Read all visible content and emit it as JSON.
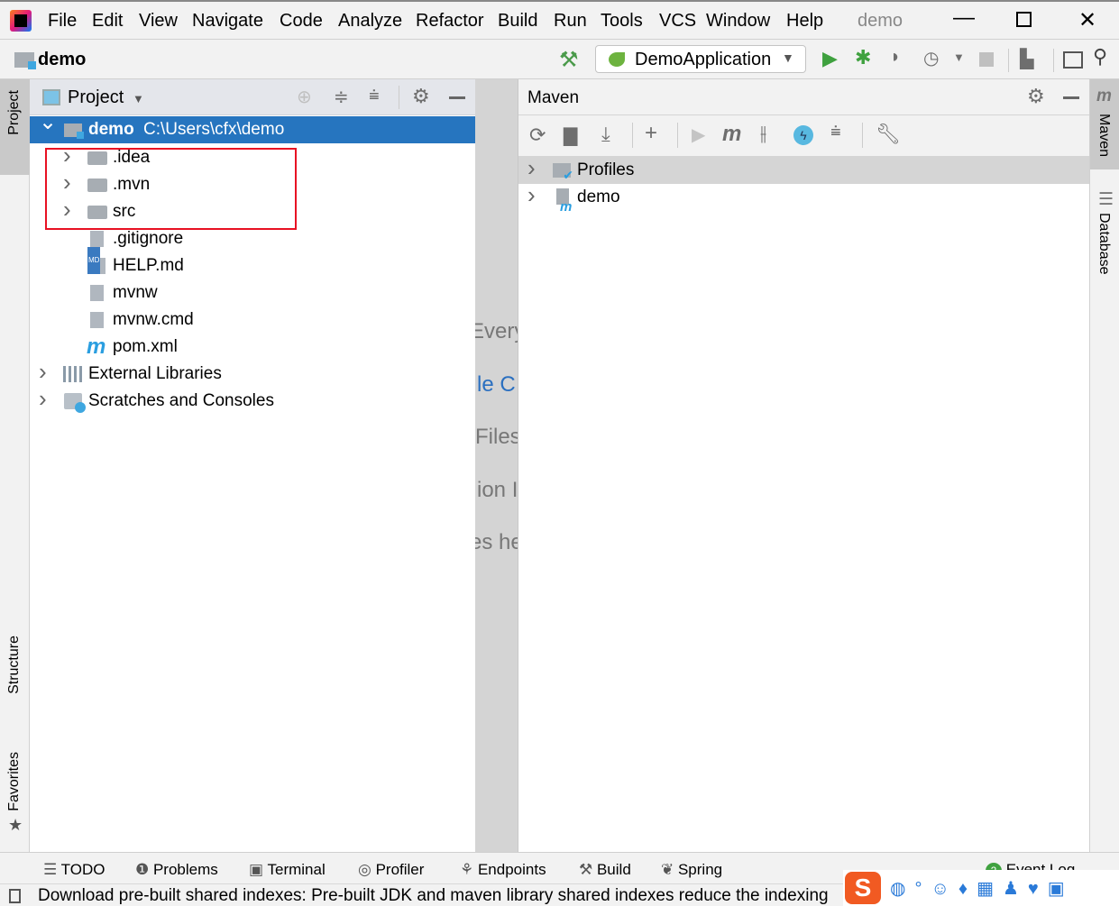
{
  "menu": {
    "items": [
      "File",
      "Edit",
      "View",
      "Navigate",
      "Code",
      "Analyze",
      "Refactor",
      "Build",
      "Run",
      "Tools",
      "VCS",
      "Window",
      "Help"
    ],
    "project_name": "demo"
  },
  "toolbar": {
    "breadcrumb": "demo",
    "run_config": "DemoApplication"
  },
  "left_stripe": {
    "tabs": [
      "Project",
      "Structure",
      "Favorites"
    ]
  },
  "project_panel": {
    "title": "Project",
    "root": {
      "name": "demo",
      "path": "C:\\Users\\cfx\\demo"
    },
    "items": [
      {
        "name": ".idea",
        "type": "folder",
        "icon": "folder-icon"
      },
      {
        "name": ".mvn",
        "type": "folder",
        "icon": "folder-icon"
      },
      {
        "name": "src",
        "type": "folder",
        "icon": "folder-icon"
      },
      {
        "name": ".gitignore",
        "type": "file",
        "icon": "gitignore-file-icon"
      },
      {
        "name": "HELP.md",
        "type": "file",
        "icon": "markdown-file-icon"
      },
      {
        "name": "mvnw",
        "type": "file",
        "icon": "script-file-icon"
      },
      {
        "name": "mvnw.cmd",
        "type": "file",
        "icon": "text-file-icon"
      },
      {
        "name": "pom.xml",
        "type": "file",
        "icon": "maven-icon"
      }
    ],
    "extra": [
      "External Libraries",
      "Scratches and Consoles"
    ],
    "highlight_color": "#e81123",
    "selection_color": "#2675bf"
  },
  "editor": {
    "hints": [
      "Every",
      "le C",
      "Files",
      "ion I",
      "es he"
    ]
  },
  "maven_panel": {
    "title": "Maven",
    "items": [
      "Profiles",
      "demo"
    ]
  },
  "right_stripe": {
    "tabs": [
      "Maven",
      "Database"
    ]
  },
  "bottom_tabs": [
    "TODO",
    "Problems",
    "Terminal",
    "Profiler",
    "Endpoints",
    "Build",
    "Spring"
  ],
  "event_log": {
    "label": "Event Log",
    "count": "2"
  },
  "status": {
    "message": "Download pre-built shared indexes: Pre-built JDK and maven library shared indexes reduce the indexing"
  }
}
